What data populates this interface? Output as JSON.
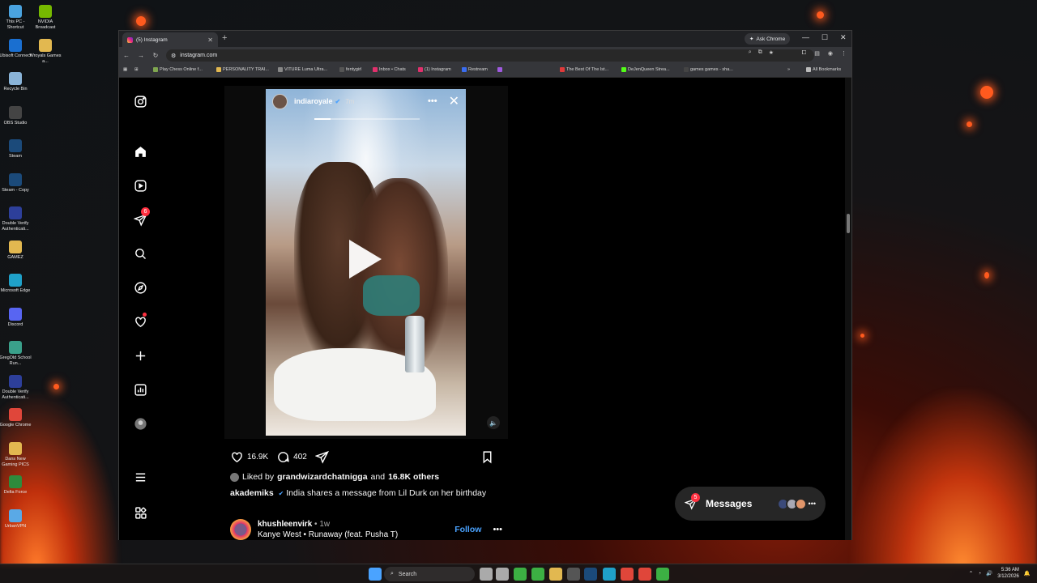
{
  "desktop": {
    "col1": [
      {
        "label": "This PC - Shortcut",
        "icon": "monitor-icon",
        "color": "#4aa3df"
      },
      {
        "label": "Ubisoft Connect",
        "icon": "ubisoft-icon",
        "color": "#1a6fd0"
      },
      {
        "label": "Recycle Bin",
        "icon": "recycle-bin-icon",
        "color": "#8ab4d8"
      },
      {
        "label": "OBS Studio",
        "icon": "obs-icon",
        "color": "#444"
      },
      {
        "label": "Steam",
        "icon": "steam-icon",
        "color": "#1b4a7a"
      },
      {
        "label": "Steam - Copy",
        "icon": "steam-icon",
        "color": "#1b4a7a"
      },
      {
        "label": "Double Verify Authenticati...",
        "icon": "shield-app-icon",
        "color": "#2d3f9a"
      },
      {
        "label": "GAMEZ",
        "icon": "folder-icon",
        "color": "#e2b850"
      },
      {
        "label": "Microsoft Edge",
        "icon": "edge-icon",
        "color": "#1fa1c9"
      },
      {
        "label": "Discord",
        "icon": "discord-icon",
        "color": "#5865f2"
      },
      {
        "label": "GregOld School Run...",
        "icon": "game-icon",
        "color": "#3aa08a"
      },
      {
        "label": "Double Verify Authenticati...",
        "icon": "shield-app-icon",
        "color": "#2d3f9a"
      },
      {
        "label": "Google Chrome",
        "icon": "chrome-icon",
        "color": "#e0463a"
      },
      {
        "label": "Dans New Gaming PICS",
        "icon": "folder-icon",
        "color": "#e2b850"
      },
      {
        "label": "Delta Force",
        "icon": "delta-force-icon",
        "color": "#2e8b3c"
      },
      {
        "label": "UrbanVPN",
        "icon": "vpn-icon",
        "color": "#5aa9e6"
      }
    ],
    "col2": [
      {
        "label": "NVIDIA Broadcast",
        "icon": "nvidia-icon",
        "color": "#76b900"
      },
      {
        "label": "Wroyals Games a...",
        "icon": "folder-icon",
        "color": "#e2b850"
      }
    ]
  },
  "browser": {
    "tab_title": "(5) Instagram",
    "new_tab": "+",
    "ask_chrome": "Ask Chrome",
    "url": "instagram.com",
    "bookmarks": [
      {
        "label": "Play Chess Online f...",
        "color": "#7fa650"
      },
      {
        "label": "PERSONALITY TRAI...",
        "color": "#e2b850"
      },
      {
        "label": "VITURE Luma Ultra...",
        "color": "#888"
      },
      {
        "label": "fentygirl",
        "color": "#555"
      },
      {
        "label": "Inbox • Chats",
        "color": "#e1306c"
      },
      {
        "label": "(1) Instagram",
        "color": "#e1306c"
      },
      {
        "label": "Restream",
        "color": "#3a6df0"
      },
      {
        "label": "",
        "color": "#a05ae0"
      },
      {
        "label": "The Best Of The Ist...",
        "color": "#e03a3a"
      },
      {
        "label": "DeJenQueen Strea...",
        "color": "#53fc18"
      },
      {
        "label": "games games - sha...",
        "color": "#444"
      }
    ],
    "more_bookmarks": "»",
    "all_bookmarks": "All Bookmarks"
  },
  "instagram": {
    "notifications_badge": "6",
    "story": {
      "username": "indiaroyale",
      "time": "7m",
      "more": "•••",
      "close": "✕",
      "progress": 0.15
    },
    "post": {
      "likes": "16.9K",
      "comments": "402",
      "liked_by_prefix": "Liked by",
      "liked_by_user": "grandwizardchatnigga",
      "liked_by_and": "and",
      "liked_by_others": "16.8K others",
      "caption_user": "akademiks",
      "caption_text": "India shares a message from Lil Durk on her birthday"
    },
    "next_post": {
      "username": "khushleenvirk",
      "time": "• 1w",
      "song": "Kanye West • Runaway (feat. Pusha T)",
      "follow": "Follow",
      "more": "•••"
    },
    "messages": {
      "label": "Messages",
      "badge": "5",
      "avatar_colors": [
        "#3b4a7a",
        "#a9a9b5",
        "#e0956a"
      ],
      "more": "•••"
    }
  },
  "taskbar": {
    "search_placeholder": "Search",
    "time": "5:36 AM",
    "date": "3/12/2026",
    "apps": [
      {
        "icon": "windows-start-icon",
        "color": "#4aa3ff"
      },
      {
        "icon": "file-icon",
        "color": "#aaa"
      },
      {
        "icon": "settings-icon",
        "color": "#aaa"
      },
      {
        "icon": "media-player-icon",
        "color": "#3cb043"
      },
      {
        "icon": "xbox-icon",
        "color": "#3cb043"
      },
      {
        "icon": "file-explorer-icon",
        "color": "#e2b850"
      },
      {
        "icon": "store-icon",
        "color": "#555"
      },
      {
        "icon": "steam-icon",
        "color": "#1b4a7a"
      },
      {
        "icon": "edge-icon",
        "color": "#1fa1c9"
      },
      {
        "icon": "chrome-icon",
        "color": "#e0463a"
      },
      {
        "icon": "chrome-active-icon",
        "color": "#e0463a"
      },
      {
        "icon": "play-icon",
        "color": "#3cb043"
      }
    ]
  }
}
